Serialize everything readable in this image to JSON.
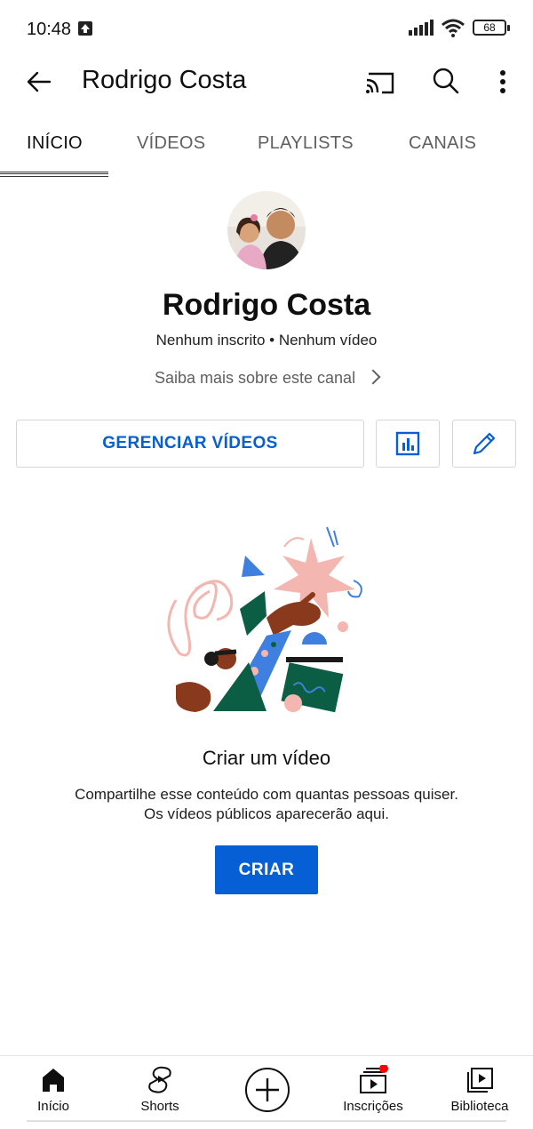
{
  "status_bar": {
    "time": "10:48",
    "battery": "68"
  },
  "header": {
    "title": "Rodrigo Costa"
  },
  "tabs": [
    {
      "label": "INÍCIO",
      "active": true
    },
    {
      "label": "VÍDEOS",
      "active": false
    },
    {
      "label": "PLAYLISTS",
      "active": false
    },
    {
      "label": "CANAIS",
      "active": false
    }
  ],
  "channel": {
    "name": "Rodrigo Costa",
    "stats": "Nenhum inscrito • Nenhum vídeo",
    "about_link": "Saiba mais sobre este canal"
  },
  "actions": {
    "manage_label": "GERENCIAR VÍDEOS"
  },
  "empty_state": {
    "title": "Criar um vídeo",
    "desc_line1": "Compartilhe esse conteúdo com quantas pessoas quiser.",
    "desc_line2": "Os vídeos públicos aparecerão aqui.",
    "create_label": "CRIAR"
  },
  "bottom_nav": [
    {
      "label": "Início",
      "icon": "home-icon"
    },
    {
      "label": "Shorts",
      "icon": "shorts-icon"
    },
    {
      "label": "",
      "icon": "create-icon"
    },
    {
      "label": "Inscrições",
      "icon": "subscriptions-icon"
    },
    {
      "label": "Biblioteca",
      "icon": "library-icon"
    }
  ],
  "colors": {
    "accent": "#065fd4",
    "notification": "#ff0000"
  }
}
